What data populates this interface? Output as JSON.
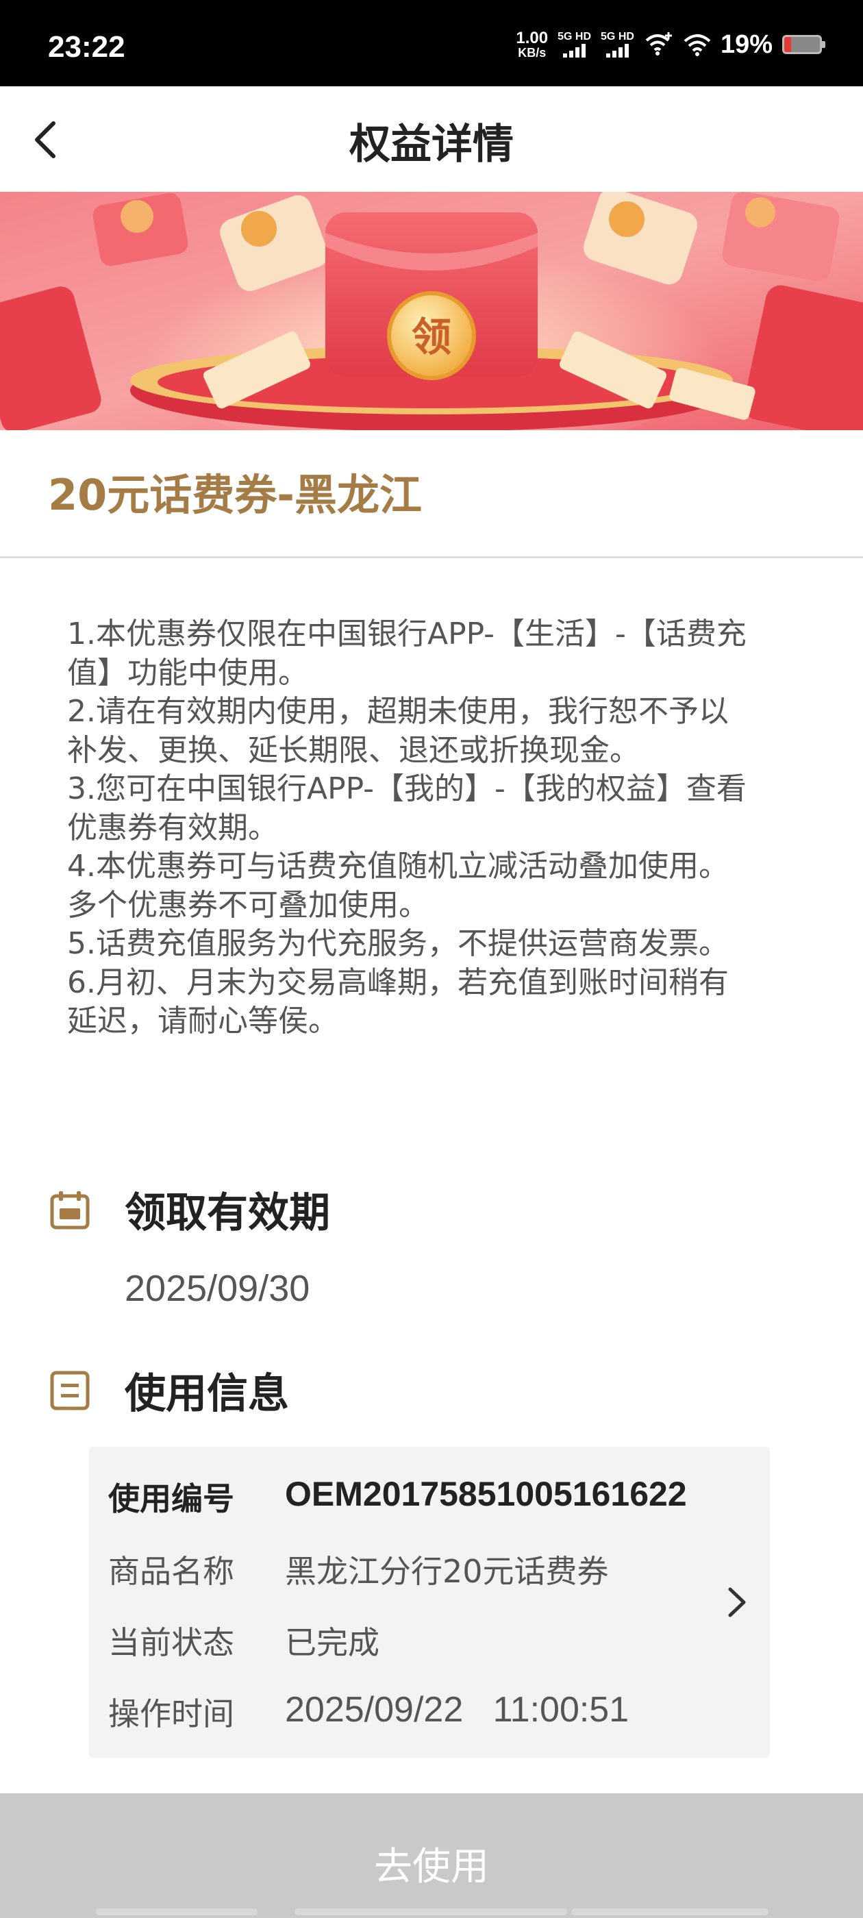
{
  "status_bar": {
    "time": "23:22",
    "net_speed_value": "1.00",
    "net_speed_unit": "KB/s",
    "sim1_label": "5G HD",
    "sim2_label": "5G HD",
    "battery_percent": "19%",
    "battery_level": 0.19,
    "battery_color": "#e53935"
  },
  "header": {
    "title": "权益详情",
    "back_icon": "chevron-left-icon"
  },
  "banner": {
    "coin_text": "领",
    "colors": {
      "primary": "#f25a63",
      "gold": "#f6c66b"
    }
  },
  "coupon": {
    "title": "20元话费券-黑龙江",
    "title_color": "#a67c46"
  },
  "rules": [
    "1.本优惠券仅限在中国银行APP-【生活】-【话费充值】功能中使用。",
    "2.请在有效期内使用，超期未使用，我行恕不予以补发、更换、延长期限、退还或折换现金。",
    "3.您可在中国银行APP-【我的】-【我的权益】查看优惠券有效期。",
    "4.本优惠券可与话费充值随机立减活动叠加使用。多个优惠券不可叠加使用。",
    "5.话费充值服务为代充服务，不提供运营商发票。",
    "6.月初、月末为交易高峰期，若充值到账时间稍有延迟，请耐心等侯。"
  ],
  "validity": {
    "icon": "calendar-icon",
    "title": "领取有效期",
    "date": "2025/09/30"
  },
  "usage": {
    "icon": "list-icon",
    "title": "使用信息",
    "rows": [
      {
        "key": "使用编号",
        "value": "OEM20175851005161622"
      },
      {
        "key": "商品名称",
        "value": "黑龙江分行20元话费券"
      },
      {
        "key": "当前状态",
        "value": "已完成"
      },
      {
        "key": "操作时间",
        "value": "2025/09/22   11:00:51"
      }
    ],
    "chevron_icon": "chevron-right-icon"
  },
  "action": {
    "button_label": "去使用",
    "button_color": "#c9c9c9"
  }
}
